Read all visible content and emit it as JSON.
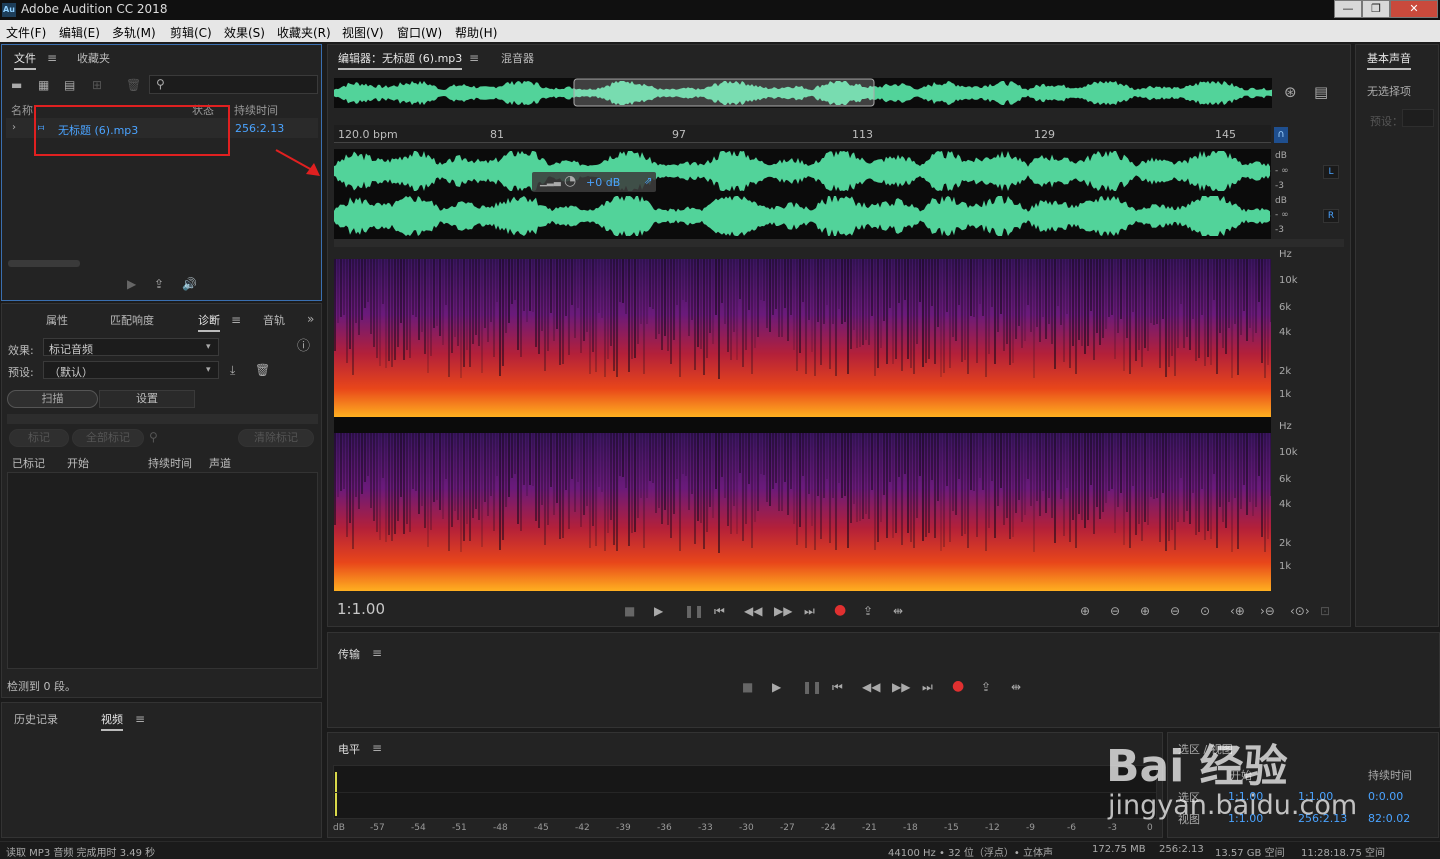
{
  "app": {
    "icon": "Au",
    "title": "Adobe Audition CC 2018"
  },
  "window_controls": [
    "—",
    "❐",
    "✕"
  ],
  "menu": [
    "文件(F)",
    "编辑(E)",
    "多轨(M)",
    "剪辑(C)",
    "效果(S)",
    "收藏夹(R)",
    "视图(V)",
    "窗口(W)",
    "帮助(H)"
  ],
  "files_panel": {
    "tabs": [
      "文件",
      "收藏夹"
    ],
    "columns": {
      "name": "名称",
      "status": "状态",
      "duration": "持续时间"
    },
    "file": {
      "name": "无标题 (6).mp3",
      "duration": "256:2.13"
    }
  },
  "diag_panel": {
    "tabs": [
      "属性",
      "匹配响度",
      "诊断",
      "音轨"
    ],
    "effect_label": "效果:",
    "effect_value": "标记音频",
    "preset_label": "预设:",
    "preset_value": "（默认）",
    "scan": "扫描",
    "settings": "设置",
    "mark": "标记",
    "mark_all": "全部标记",
    "clear_marks": "清除标记",
    "cols": [
      "已标记",
      "开始",
      "持续时间",
      "声道"
    ],
    "status": "检测到 0 段。"
  },
  "history_panel": {
    "tabs": [
      "历史记录",
      "视频"
    ]
  },
  "editor": {
    "tabs": [
      "编辑器：无标题 (6).mp3",
      "混音器"
    ],
    "ruler": [
      "120.0 bpm",
      "81",
      "97",
      "113",
      "129",
      "145"
    ],
    "hud_gain": "+0 dB",
    "db_scale": [
      "dB",
      "- ∞",
      "-3"
    ],
    "channels": [
      "L",
      "R"
    ],
    "hz_scale": [
      "Hz",
      "10k",
      "6k",
      "4k",
      "2k",
      "1k"
    ],
    "timecode": "1:1.00"
  },
  "essential_sound": {
    "title": "基本声音",
    "no_selection": "无选择项",
    "preset_label": "预设："
  },
  "transport_panel": {
    "title": "传输"
  },
  "level_panel": {
    "title": "电平",
    "scale": [
      "dB",
      "-57",
      "-54",
      "-51",
      "-48",
      "-45",
      "-42",
      "-39",
      "-36",
      "-33",
      "-30",
      "-27",
      "-24",
      "-21",
      "-18",
      "-15",
      "-12",
      "-9",
      "-6",
      "-3",
      "0"
    ]
  },
  "selection_panel": {
    "title": "选区 / 视图",
    "col_start": "开始",
    "col_duration": "持续时间",
    "row_selection": "选区",
    "row_view": "视图",
    "sel_start": "1:1.00",
    "sel_end": "1:1.00",
    "sel_duration": "0:0.00",
    "view_start": "1:1.00",
    "view_end": "256:2.13",
    "view_duration": "82:0.02"
  },
  "statusbar": {
    "left": "读取 MP3 音频 完成用时 3.49 秒",
    "items": [
      "44100 Hz • 32 位（浮点）• 立体声",
      "172.75 MB",
      "256:2.13",
      "13.57 GB 空间",
      "11:28:18.75 空间"
    ]
  },
  "watermark": {
    "logo": "Bai 经验",
    "url": "jingyan.baidu.com"
  },
  "colors": {
    "waveform": "#52d39a",
    "accent": "#4aa3ff",
    "highlight_box": "#e02020",
    "record": "#e03030"
  }
}
